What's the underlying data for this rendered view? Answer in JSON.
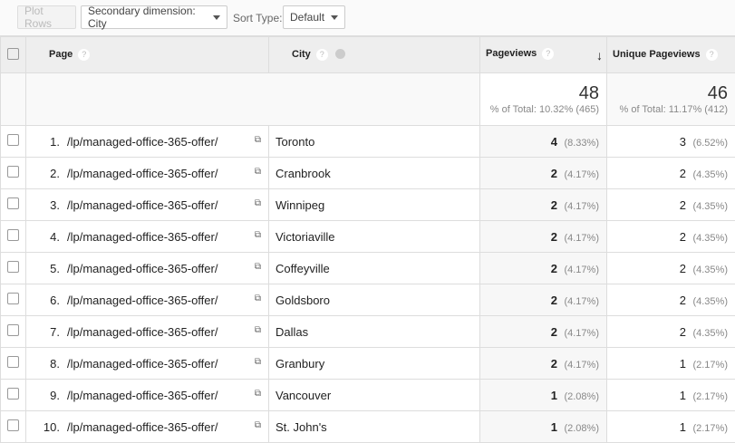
{
  "toolbar": {
    "plot_rows": "Plot Rows",
    "secondary_dimension": "Secondary dimension: City",
    "sort_type_label": "Sort Type:",
    "sort_type_value": "Default"
  },
  "headers": {
    "page": "Page",
    "city": "City",
    "pageviews": "Pageviews",
    "unique_pageviews": "Unique Pageviews",
    "help": "?",
    "sort_arrow": "↓"
  },
  "totals": {
    "pageviews": "48",
    "pageviews_sub": "% of Total: 10.32% (465)",
    "unique": "46",
    "unique_sub": "% of Total: 11.17% (412)"
  },
  "rows": [
    {
      "n": "1.",
      "page": "/lp/managed-office-365-offer/",
      "city": "Toronto",
      "pv": "4",
      "pv_pct": "(8.33%)",
      "upv": "3",
      "upv_pct": "(6.52%)"
    },
    {
      "n": "2.",
      "page": "/lp/managed-office-365-offer/",
      "city": "Cranbrook",
      "pv": "2",
      "pv_pct": "(4.17%)",
      "upv": "2",
      "upv_pct": "(4.35%)"
    },
    {
      "n": "3.",
      "page": "/lp/managed-office-365-offer/",
      "city": "Winnipeg",
      "pv": "2",
      "pv_pct": "(4.17%)",
      "upv": "2",
      "upv_pct": "(4.35%)"
    },
    {
      "n": "4.",
      "page": "/lp/managed-office-365-offer/",
      "city": "Victoriaville",
      "pv": "2",
      "pv_pct": "(4.17%)",
      "upv": "2",
      "upv_pct": "(4.35%)"
    },
    {
      "n": "5.",
      "page": "/lp/managed-office-365-offer/",
      "city": "Coffeyville",
      "pv": "2",
      "pv_pct": "(4.17%)",
      "upv": "2",
      "upv_pct": "(4.35%)"
    },
    {
      "n": "6.",
      "page": "/lp/managed-office-365-offer/",
      "city": "Goldsboro",
      "pv": "2",
      "pv_pct": "(4.17%)",
      "upv": "2",
      "upv_pct": "(4.35%)"
    },
    {
      "n": "7.",
      "page": "/lp/managed-office-365-offer/",
      "city": "Dallas",
      "pv": "2",
      "pv_pct": "(4.17%)",
      "upv": "2",
      "upv_pct": "(4.35%)"
    },
    {
      "n": "8.",
      "page": "/lp/managed-office-365-offer/",
      "city": "Granbury",
      "pv": "2",
      "pv_pct": "(4.17%)",
      "upv": "1",
      "upv_pct": "(2.17%)"
    },
    {
      "n": "9.",
      "page": "/lp/managed-office-365-offer/",
      "city": "Vancouver",
      "pv": "1",
      "pv_pct": "(2.08%)",
      "upv": "1",
      "upv_pct": "(2.17%)"
    },
    {
      "n": "10.",
      "page": "/lp/managed-office-365-offer/",
      "city": "St. John's",
      "pv": "1",
      "pv_pct": "(2.08%)",
      "upv": "1",
      "upv_pct": "(2.17%)"
    }
  ]
}
